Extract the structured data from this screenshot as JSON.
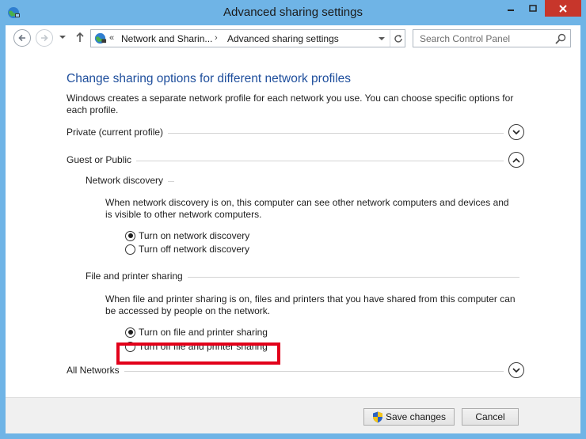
{
  "window": {
    "title": "Advanced sharing settings"
  },
  "address_bar": {
    "overflow": "«",
    "crumbs": [
      "Network and Sharin...",
      "Advanced sharing settings"
    ],
    "separator": "›"
  },
  "search": {
    "placeholder": "Search Control Panel"
  },
  "content": {
    "heading": "Change sharing options for different network profiles",
    "description": "Windows creates a separate network profile for each network you use. You can choose specific options for each profile.",
    "profiles": [
      {
        "label": "Private (current profile)",
        "expanded": false
      },
      {
        "label": "Guest or Public",
        "expanded": true
      },
      {
        "label": "All Networks",
        "expanded": false
      }
    ],
    "network_discovery": {
      "title": "Network discovery",
      "text": "When network discovery is on, this computer can see other network computers and devices and is visible to other network computers.",
      "options": [
        "Turn on network discovery",
        "Turn off network discovery"
      ],
      "selected": 0
    },
    "file_sharing": {
      "title": "File and printer sharing",
      "text": "When file and printer sharing is on, files and printers that you have shared from this computer can be accessed by people on the network.",
      "options": [
        "Turn on file and printer sharing",
        "Turn off file and printer sharing"
      ],
      "selected": 0
    }
  },
  "footer": {
    "save_label": "Save changes",
    "cancel_label": "Cancel"
  },
  "colors": {
    "frame": "#6fb4e6",
    "heading": "#1e4e9c",
    "highlight": "#e2001a",
    "close": "#c7362b"
  },
  "icons": {
    "app": "network-globe-icon",
    "back": "back-arrow-icon",
    "forward": "forward-arrow-icon",
    "up": "up-arrow-icon",
    "refresh": "refresh-icon",
    "search": "magnifier-icon",
    "shield": "uac-shield-icon"
  }
}
